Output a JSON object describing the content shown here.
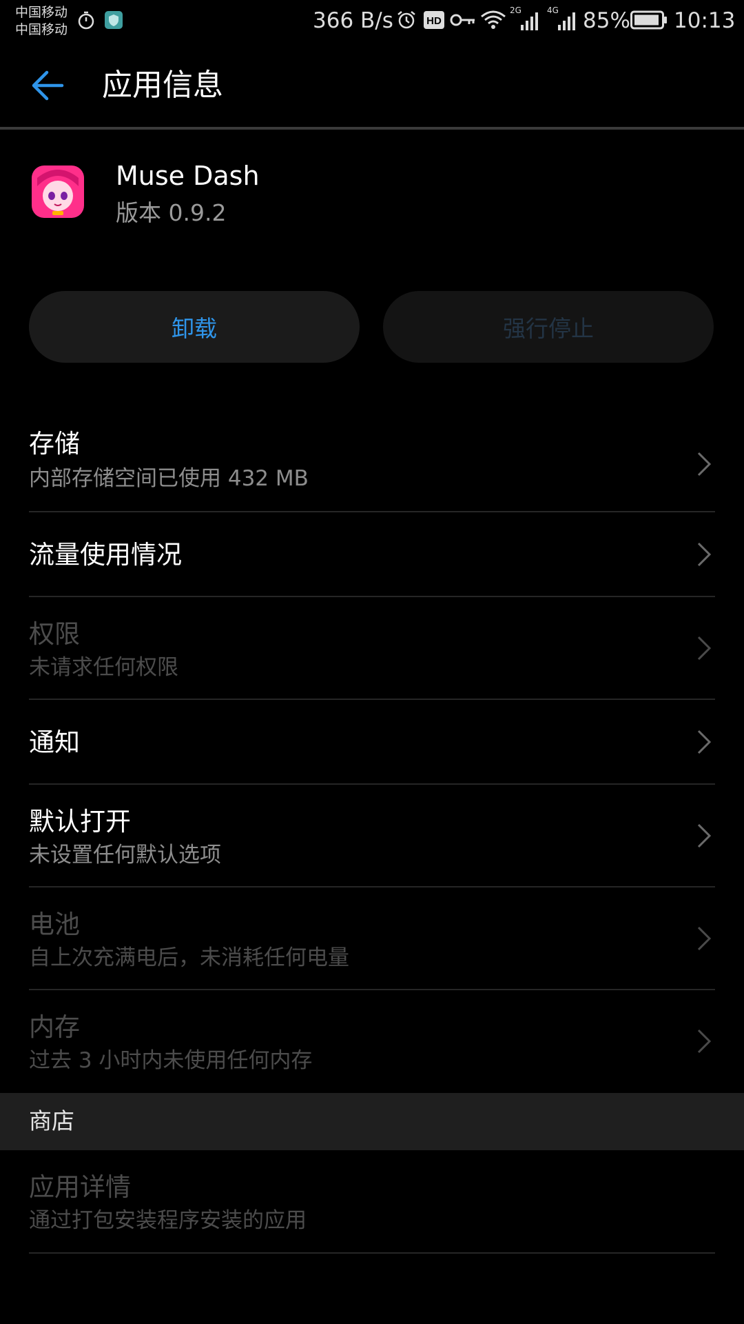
{
  "status_bar": {
    "carrier1": "中国移动",
    "carrier2": "中国移动",
    "net_speed": "366 B/s",
    "sig2g": "2G",
    "sig4g": "4G",
    "battery": "85%",
    "time": "10:13",
    "icons": [
      "stopwatch-icon",
      "shield-icon",
      "alarm-icon",
      "hd-icon",
      "key-icon",
      "wifi-icon",
      "signal-icon",
      "battery-icon"
    ]
  },
  "appbar": {
    "title": "应用信息"
  },
  "app": {
    "name": "Muse Dash",
    "version": "版本 0.9.2"
  },
  "buttons": {
    "uninstall": "卸载",
    "force_stop": "强行停止"
  },
  "rows": [
    {
      "title": "存储",
      "subtitle": "内部存储空间已使用 432 MB",
      "enabled": true
    },
    {
      "title": "流量使用情况",
      "enabled": true
    },
    {
      "title": "权限",
      "subtitle": "未请求任何权限",
      "enabled": false
    },
    {
      "title": "通知",
      "enabled": true
    },
    {
      "title": "默认打开",
      "subtitle": "未设置任何默认选项",
      "enabled": true
    },
    {
      "title": "电池",
      "subtitle": "自上次充满电后，未消耗任何电量",
      "enabled": false
    },
    {
      "title": "内存",
      "subtitle": "过去 3 小时内未使用任何内存",
      "enabled": false
    }
  ],
  "section": {
    "label": "商店"
  },
  "store_row": {
    "title": "应用详情",
    "subtitle": "通过打包安装程序安装的应用",
    "enabled": false
  },
  "colors": {
    "accent": "#2f95ea",
    "background": "#000000",
    "disabled_text": "#4c4c4c"
  }
}
